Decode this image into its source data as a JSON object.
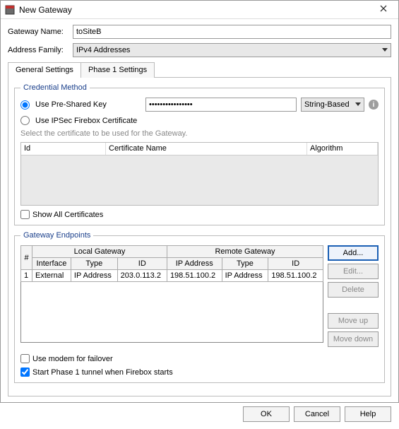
{
  "window": {
    "title": "New Gateway"
  },
  "form": {
    "gateway_name_label": "Gateway Name:",
    "gateway_name_value": "toSiteB",
    "address_family_label": "Address Family:",
    "address_family_value": "IPv4 Addresses"
  },
  "tabs": {
    "general": "General Settings",
    "phase1": "Phase 1 Settings"
  },
  "credential": {
    "legend": "Credential Method",
    "use_psk_label": "Use Pre-Shared Key",
    "psk_value": "••••••••••••••••",
    "psk_type_value": "String-Based",
    "use_cert_label": "Use IPSec Firebox Certificate",
    "cert_hint": "Select the certificate to be used for the Gateway.",
    "col_id": "Id",
    "col_certname": "Certificate Name",
    "col_alg": "Algorithm",
    "show_all_label": "Show All Certificates"
  },
  "endpoints": {
    "legend": "Gateway Endpoints",
    "col_num": "#",
    "group_local": "Local Gateway",
    "group_remote": "Remote Gateway",
    "col_interface": "Interface",
    "col_type": "Type",
    "col_id": "ID",
    "col_ipaddr": "IP Address",
    "rows": [
      {
        "num": "1",
        "interface": "External",
        "local_type": "IP Address",
        "local_id": "203.0.113.2",
        "remote_ip": "198.51.100.2",
        "remote_type": "IP Address",
        "remote_id": "198.51.100.2"
      }
    ],
    "btn_add": "Add...",
    "btn_edit": "Edit...",
    "btn_delete": "Delete",
    "btn_moveup": "Move up",
    "btn_movedown": "Move down"
  },
  "options": {
    "modem_failover": "Use modem for failover",
    "start_phase1": "Start Phase 1 tunnel when Firebox starts"
  },
  "footer": {
    "ok": "OK",
    "cancel": "Cancel",
    "help": "Help"
  }
}
